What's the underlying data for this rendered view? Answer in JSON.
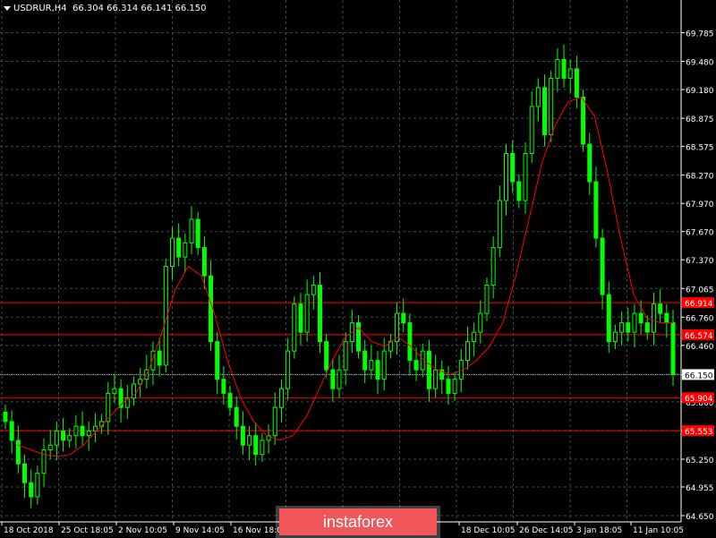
{
  "header": {
    "symbol": "USDRUR,H4",
    "ohlc": "66.304 66.314 66.141 66.150"
  },
  "watermark": "instaforex",
  "colors": {
    "background": "#000000",
    "grid": "#2f4f4f",
    "candle": "#00ff00",
    "ma": "#ff0000",
    "level": "#ff0000",
    "current": "#c0c0c0",
    "text": "#ffffff"
  },
  "chart_data": {
    "type": "line",
    "title": "USDRUR,H4",
    "ylim": [
      64.65,
      69.98
    ],
    "y_ticks": [
      "69.785",
      "69.480",
      "69.180",
      "68.875",
      "68.575",
      "68.270",
      "67.970",
      "67.670",
      "67.370",
      "67.065",
      "66.760",
      "66.460",
      "66.150",
      "65.860",
      "65.555",
      "65.250",
      "64.955",
      "64.650"
    ],
    "x_ticks": [
      "18 Oct 2018",
      "25 Oct 18:05",
      "2 Nov 10:05",
      "9 Nov 14:05",
      "16 Nov 18:05",
      "",
      "18 Dec 10:05",
      "26 Dec 14:05",
      "3 Jan 18:05",
      "11 Jan 10:05"
    ],
    "x_tick_note": "tick labels partly hidden by watermark",
    "horizontal_levels": [
      {
        "label": "66.914",
        "value": 66.914
      },
      {
        "label": "66.574",
        "value": 66.574
      },
      {
        "label": "65.904",
        "value": 65.904
      },
      {
        "label": "65.553",
        "value": 65.553
      }
    ],
    "current_price": {
      "label": "66.150",
      "value": 66.15
    },
    "series": [
      {
        "kind": "candles",
        "closes": [
          65.65,
          65.45,
          65.2,
          65.0,
          64.85,
          65.1,
          65.35,
          65.4,
          65.55,
          65.45,
          65.5,
          65.6,
          65.5,
          65.55,
          65.6,
          65.65,
          65.95,
          66.0,
          65.8,
          65.9,
          66.05,
          66.1,
          66.2,
          66.4,
          66.25,
          67.3,
          67.6,
          67.4,
          67.55,
          67.8,
          67.5,
          67.2,
          66.5,
          66.1,
          65.95,
          65.8,
          65.6,
          65.4,
          65.5,
          65.3,
          65.45,
          65.5,
          65.8,
          66.0,
          66.4,
          66.9,
          66.6,
          67.0,
          67.1,
          66.5,
          66.2,
          66.0,
          66.2,
          66.5,
          66.7,
          66.4,
          66.2,
          66.3,
          66.1,
          66.4,
          66.5,
          66.8,
          66.7,
          66.3,
          66.2,
          66.4,
          66.0,
          66.2,
          66.1,
          65.95,
          66.1,
          66.3,
          66.5,
          66.6,
          66.8,
          67.1,
          67.5,
          68.0,
          68.5,
          68.2,
          68.0,
          68.5,
          69.0,
          69.2,
          68.7,
          69.3,
          69.5,
          69.3,
          69.4,
          69.1,
          68.6,
          68.2,
          67.6,
          67.0,
          66.5,
          66.6,
          66.7,
          66.6,
          66.8,
          66.7,
          66.6,
          66.9,
          66.8,
          66.7,
          66.15
        ]
      },
      {
        "kind": "moving_average",
        "values": [
          65.4,
          65.35,
          65.3,
          65.28,
          65.3,
          65.4,
          65.55,
          65.7,
          65.85,
          65.95,
          66.2,
          66.6,
          67.05,
          67.3,
          67.2,
          66.8,
          66.3,
          65.9,
          65.65,
          65.5,
          65.45,
          65.5,
          65.7,
          66.0,
          66.3,
          66.55,
          66.65,
          66.5,
          66.45,
          66.55,
          66.45,
          66.3,
          66.2,
          66.15,
          66.2,
          66.3,
          66.45,
          66.7,
          67.2,
          67.8,
          68.4,
          68.8,
          69.05,
          69.1,
          68.9,
          68.3,
          67.6,
          67.0,
          66.75,
          66.7,
          66.7
        ]
      }
    ]
  }
}
